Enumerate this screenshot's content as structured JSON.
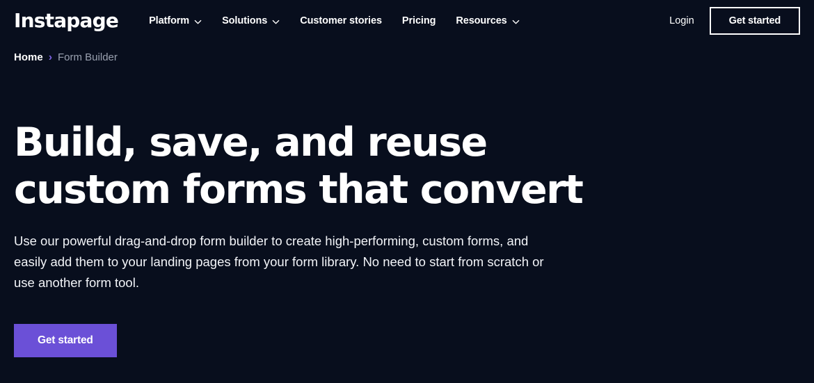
{
  "brand": {
    "logo_text": "Instapage",
    "accent_color": "#6b50d7",
    "background_color": "#080e1d",
    "text_color": "#ffffff",
    "muted_text_color": "#9aa1b0"
  },
  "header": {
    "nav_items": [
      {
        "label": "Platform",
        "has_dropdown": true,
        "icon": "chevron-down-icon"
      },
      {
        "label": "Solutions",
        "has_dropdown": true,
        "icon": "chevron-down-icon"
      },
      {
        "label": "Customer stories",
        "has_dropdown": false
      },
      {
        "label": "Pricing",
        "has_dropdown": false
      },
      {
        "label": "Resources",
        "has_dropdown": true,
        "icon": "chevron-down-icon"
      }
    ],
    "login_label": "Login",
    "get_started_label": "Get started"
  },
  "breadcrumb": {
    "home_label": "Home",
    "separator": "›",
    "separator_icon": "chevron-right-icon",
    "current_label": "Form Builder"
  },
  "hero": {
    "title_line_1": "Build, save, and reuse",
    "title_line_2": "custom forms that convert",
    "subtitle": "Use our powerful drag-and-drop form builder to create high-performing, custom forms, and easily add them to your landing pages from your form library. No need to start from scratch or use another form tool.",
    "cta_label": "Get started"
  }
}
